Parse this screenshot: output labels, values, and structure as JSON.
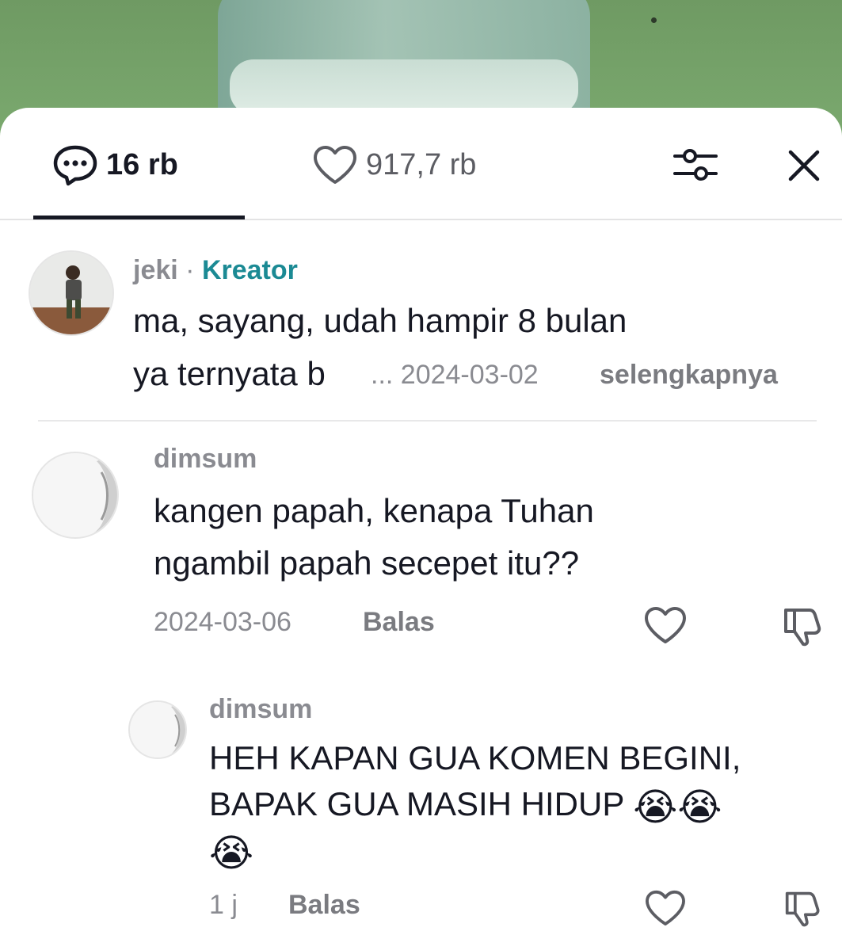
{
  "header": {
    "comment_count": "16 rb",
    "like_count": "917,7 rb"
  },
  "comments": [
    {
      "username": "jeki",
      "separator": "·",
      "badge": "Kreator",
      "line1": "ma, sayang, udah hampir 8 bulan",
      "line2_visible": "ya ternyata b",
      "ellipsis": "...",
      "date": "2024-03-02",
      "more": "selengkapnya"
    },
    {
      "username": "dimsum",
      "line1": "kangen papah, kenapa Tuhan",
      "line2": "ngambil papah secepet itu??",
      "date": "2024-03-06",
      "reply": "Balas"
    },
    {
      "username": "dimsum",
      "line1": "HEH KAPAN GUA KOMEN BEGINI,",
      "line2": "BAPAK GUA MASIH HIDUP",
      "emoji": "😭",
      "time": "1 j",
      "reply": "Balas"
    }
  ],
  "icons": {
    "comments": "comment-bubble-icon",
    "likes": "heart-icon",
    "filter": "sliders-icon",
    "close": "close-icon",
    "like": "heart-outline-icon",
    "dislike": "thumbs-down-icon"
  },
  "colors": {
    "creator_badge": "#1b8a94",
    "muted_text": "#8a8b91",
    "primary_text": "#161823"
  }
}
